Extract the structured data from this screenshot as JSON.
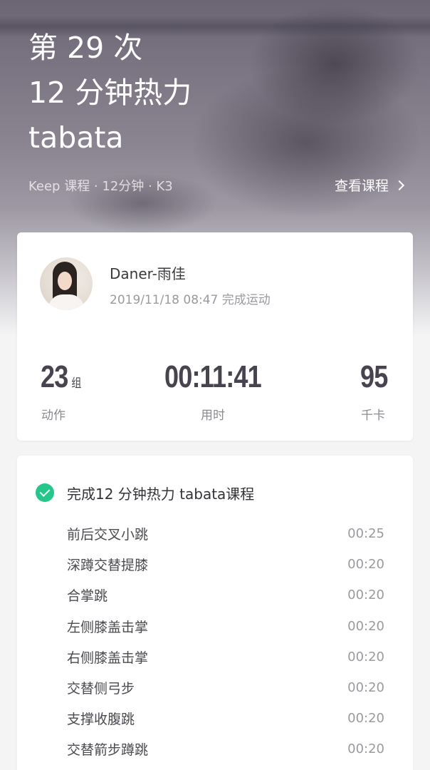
{
  "hero": {
    "title_lines": [
      "第 29 次",
      "12 分钟热力",
      "tabata"
    ],
    "meta": "Keep 课程 · 12分钟 · K3",
    "view_course_label": "查看课程"
  },
  "user_card": {
    "username": "Daner-雨佳",
    "finish_time": "2019/11/18 08:47 完成运动",
    "stats": [
      {
        "value": "23",
        "unit": "组",
        "label": "动作"
      },
      {
        "value": "00:11:41",
        "unit": "",
        "label": "用时"
      },
      {
        "value": "95",
        "unit": "",
        "label": "千卡"
      }
    ]
  },
  "course_card": {
    "title": "完成12 分钟热力 tabata课程",
    "exercises": [
      {
        "name": "前后交叉小跳",
        "time": "00:25"
      },
      {
        "name": "深蹲交替提膝",
        "time": "00:20"
      },
      {
        "name": "合掌跳",
        "time": "00:20"
      },
      {
        "name": "左侧膝盖击掌",
        "time": "00:20"
      },
      {
        "name": "右侧膝盖击掌",
        "time": "00:20"
      },
      {
        "name": "交替侧弓步",
        "time": "00:20"
      },
      {
        "name": "支撑收腹跳",
        "time": "00:20"
      },
      {
        "name": "交替箭步蹲跳",
        "time": "00:20"
      }
    ]
  },
  "colors": {
    "accent_green": "#24c789",
    "stat_text": "#47434f",
    "hero_overlay": "#7b7583"
  },
  "icons": [
    "chevron-right-icon",
    "check-circle-icon",
    "avatar-photo"
  ]
}
